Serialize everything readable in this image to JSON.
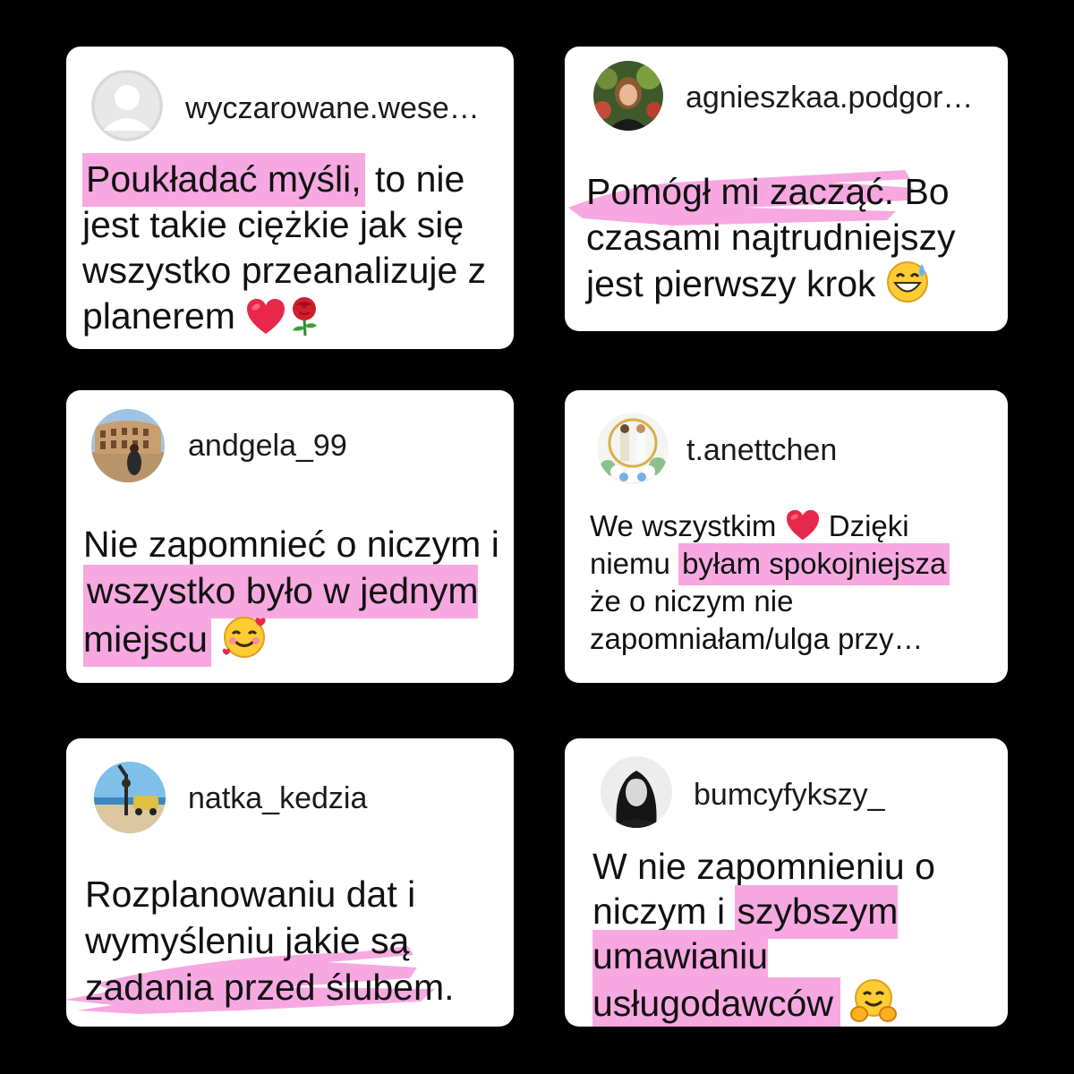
{
  "colors": {
    "background": "#000000",
    "card": "#ffffff",
    "highlight": "#f7a8e1"
  },
  "cards": [
    {
      "username": "wyczarowane.wese…",
      "avatar": "default-avatar",
      "highlight": "Poukładać myśli,",
      "text_after": " to nie jest takie ciężkie jak się wszystko przeanalizuje z planerem",
      "emoji": [
        "heart",
        "rose"
      ]
    },
    {
      "username": "agnieszkaa.podgor…",
      "avatar": "woman-photo-avatar",
      "highlight": "Pomógł mi zacząć.",
      "text_after": " Bo czasami najtrudniejszy jest pierwszy krok",
      "emoji": [
        "grinning-sweat"
      ]
    },
    {
      "username": "andgela_99",
      "avatar": "colosseum-photo-avatar",
      "text_before": "Nie zapomnieć o niczym i ",
      "highlight": "wszystko było w jednym miejscu",
      "emoji": [
        "smiling-hearts"
      ]
    },
    {
      "username": "t.anettchen",
      "avatar": "wedding-photo-avatar",
      "text_before": "We wszystkim",
      "emoji": [
        "heart"
      ],
      "text_middle": " Dzięki niemu ",
      "highlight": "byłam spokojniejsza",
      "text_after": " że o niczym nie zapomniałam/ulga przy…"
    },
    {
      "username": "natka_kedzia",
      "avatar": "beach-photo-avatar",
      "text_before": "Rozplanowaniu dat i wymyśleniu jakie są ",
      "highlight": "zadania przed ślubem."
    },
    {
      "username": "bumcyfykszy_",
      "avatar": "bw-portrait-avatar",
      "text_before": "W nie zapomnieniu o niczym i ",
      "highlight": " szybszym umawianiu usługodawców",
      "emoji": [
        "hugging"
      ]
    }
  ]
}
